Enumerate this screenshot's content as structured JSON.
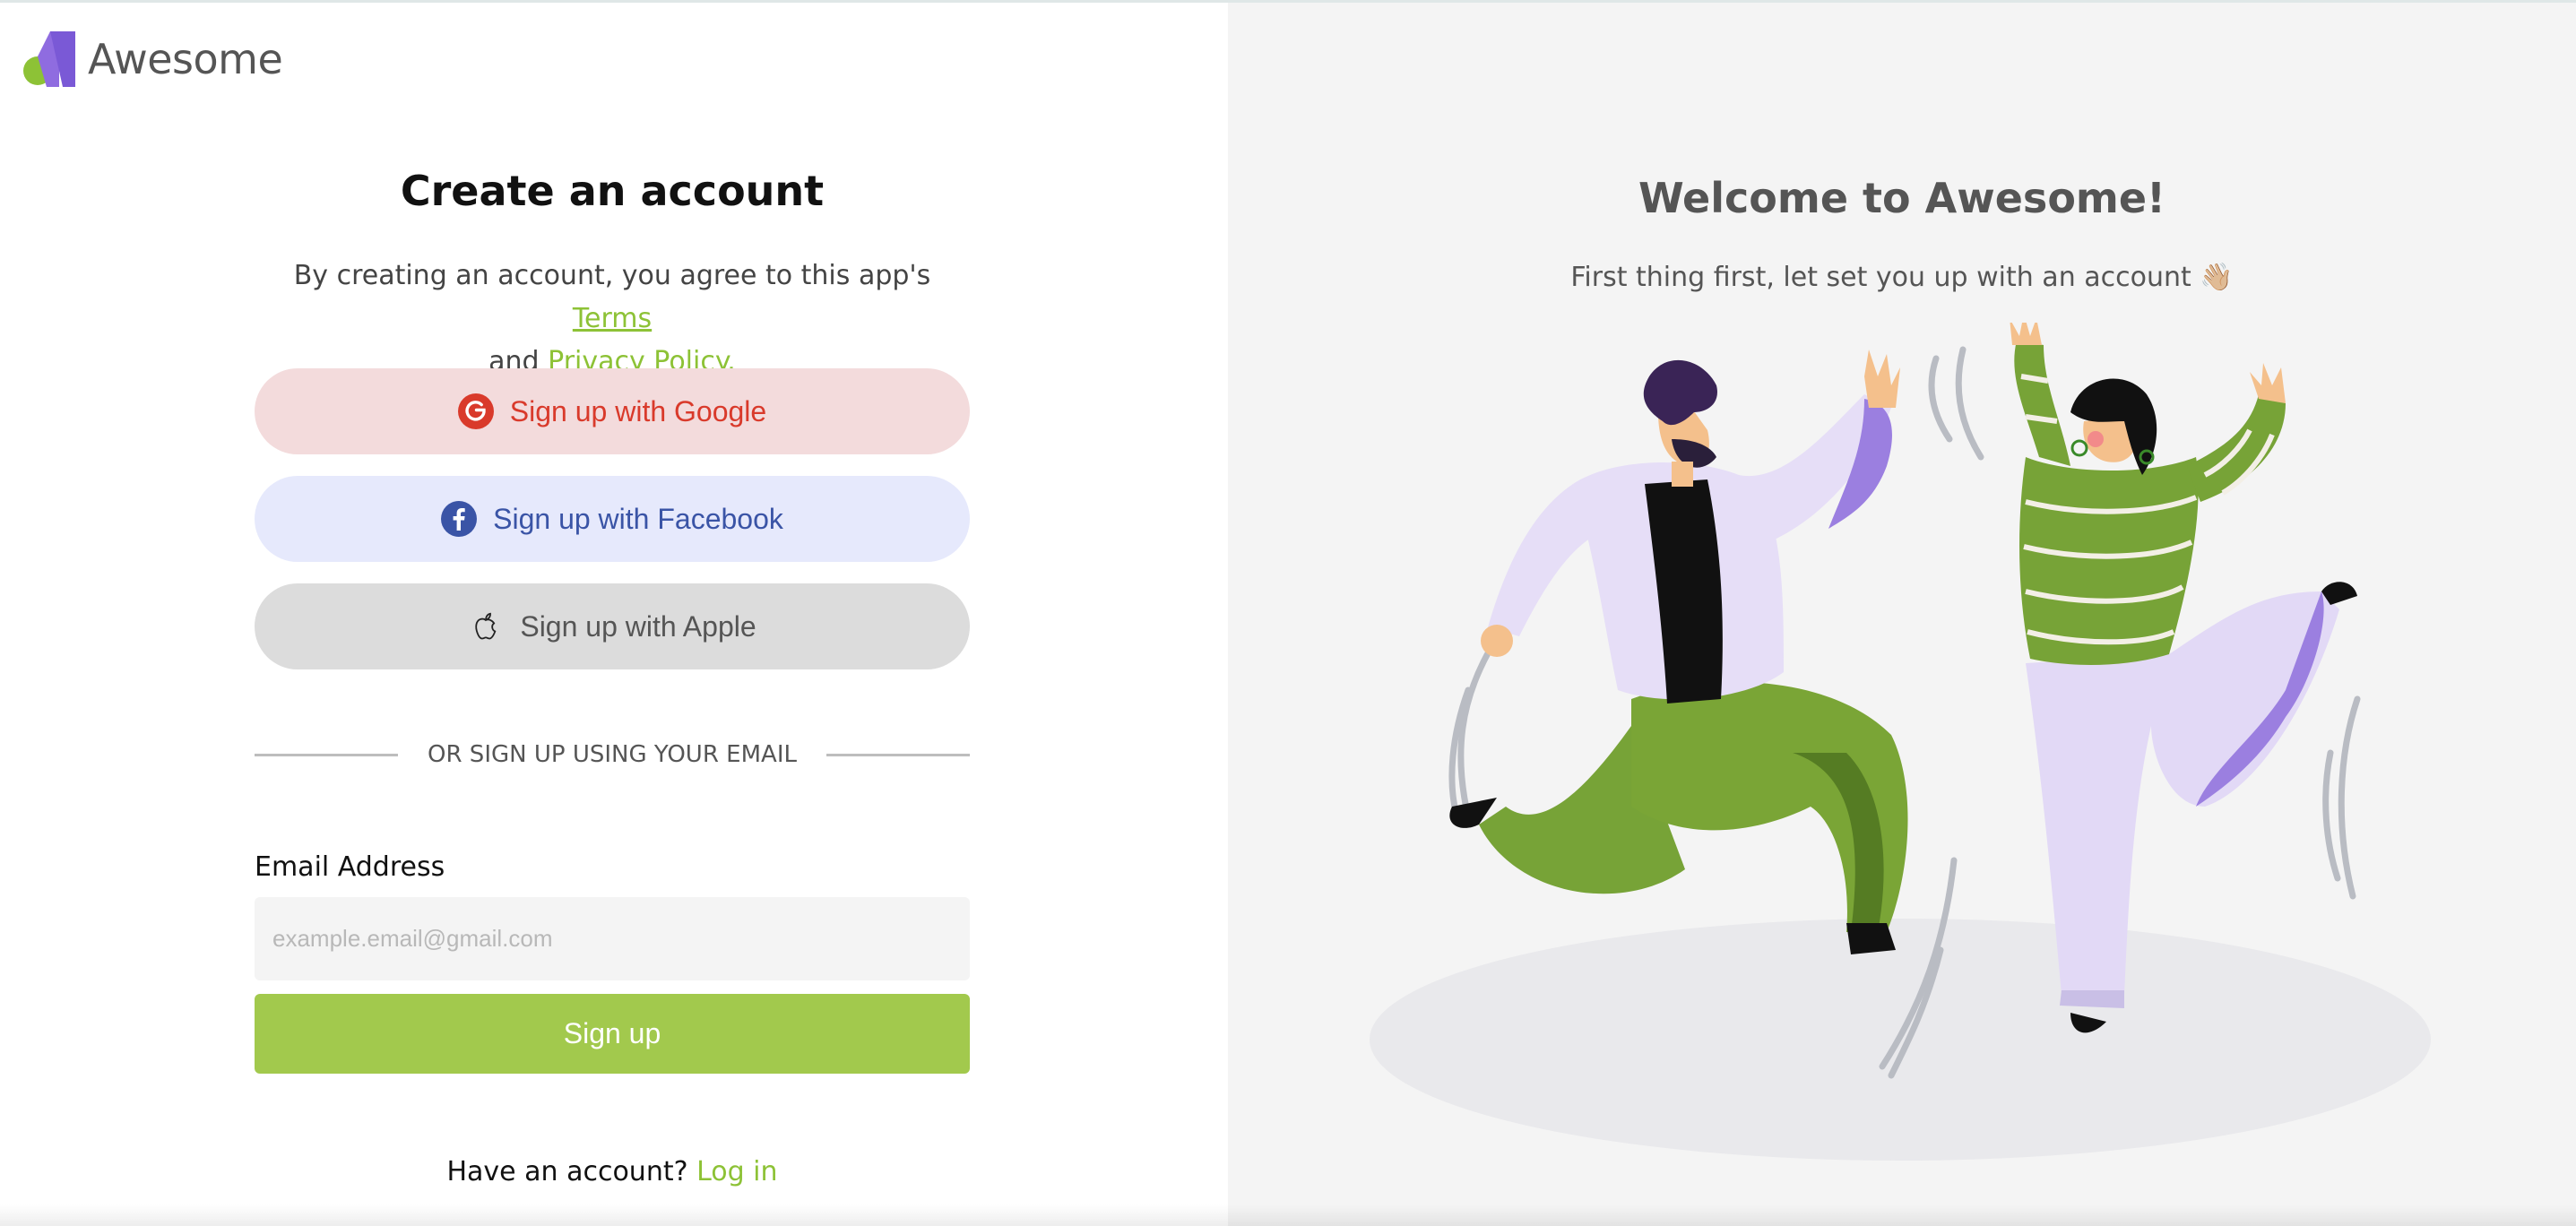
{
  "brand": {
    "name": "Awesome"
  },
  "form": {
    "title": "Create an account",
    "terms_prefix": "By creating an account, you agree to this app's",
    "terms_link": "Terms",
    "terms_and": "and",
    "privacy_link": "Privacy Policy.",
    "google_label": "Sign up with Google",
    "facebook_label": "Sign up with Facebook",
    "apple_label": "Sign up with Apple",
    "divider_text": "OR SIGN UP USING YOUR EMAIL",
    "email_label": "Email Address",
    "email_placeholder": "example.email@gmail.com",
    "email_value": "",
    "signup_label": "Sign up",
    "have_account": "Have an account?",
    "login_link": "Log in"
  },
  "hero": {
    "title": "Welcome to Awesome!",
    "subtitle": "First thing first, let set you up with an account 👋🏼"
  },
  "colors": {
    "accent_green": "#a2c94d",
    "link_green": "#8dc236",
    "google_bg": "#f3dbdc",
    "google_text": "#d93a2b",
    "facebook_bg": "#e6e9fc",
    "facebook_text": "#3a54a6",
    "apple_bg": "#dcdcdc",
    "panel_bg": "#f4f4f4"
  },
  "icons": {
    "logo": "awesome-logo-icon",
    "google": "google-icon",
    "facebook": "facebook-icon",
    "apple": "apple-icon"
  }
}
